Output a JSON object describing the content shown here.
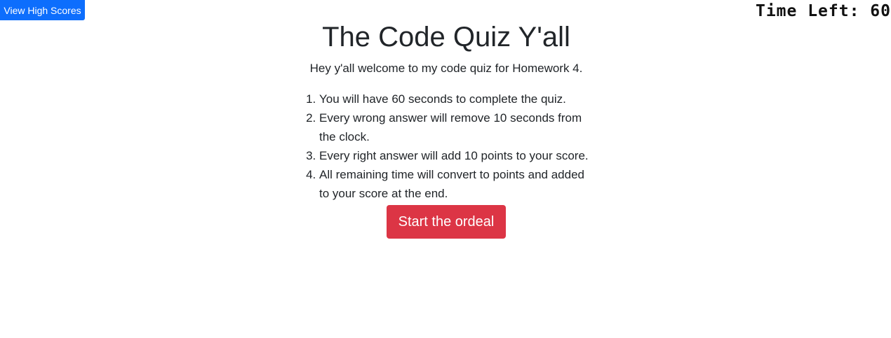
{
  "header": {
    "high_scores_label": "View High Scores",
    "timer_label": "Time Left: ",
    "timer_value": "60"
  },
  "main": {
    "title": "The Code Quiz Y'all",
    "subtitle": "Hey y'all welcome to my code quiz for Homework 4.",
    "rules": [
      "You will have 60 seconds to complete the quiz.",
      "Every wrong answer will remove 10 seconds from the clock.",
      "Every right answer will add 10 points to your score.",
      "All remaining time will convert to points and added to your score at the end."
    ],
    "start_label": "Start the ordeal"
  }
}
